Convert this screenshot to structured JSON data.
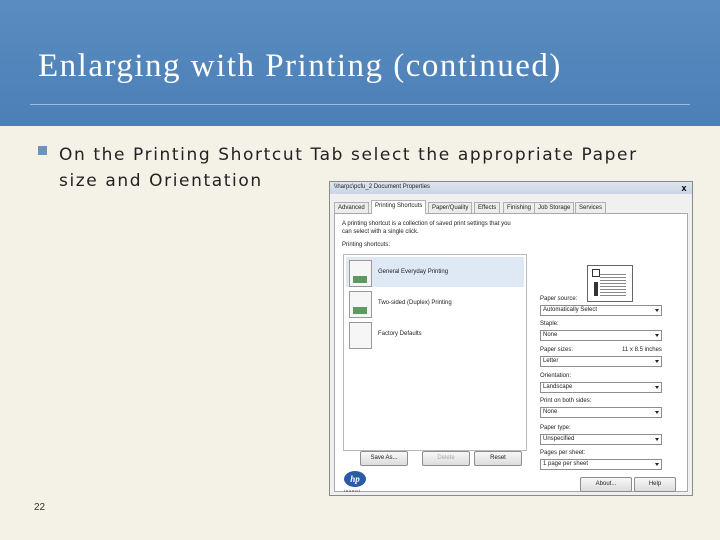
{
  "slide": {
    "title": "Enlarging with Printing (continued)",
    "bullet": "On the Printing Shortcut Tab select the appropriate Paper size and Orientation",
    "slide_number": "22"
  },
  "dialog": {
    "title": "\\\\harpc\\pcfu_2 Document Properties",
    "close_glyph": "x",
    "tabs": [
      {
        "label": "Advanced",
        "active": false
      },
      {
        "label": "Printing Shortcuts",
        "active": true
      },
      {
        "label": "Paper/Quality",
        "active": false
      },
      {
        "label": "Effects",
        "active": false
      },
      {
        "label": "Finishing",
        "active": false
      },
      {
        "label": "Job Storage",
        "active": false
      },
      {
        "label": "Services",
        "active": false
      }
    ],
    "description": "A printing shortcut is a collection of saved print settings that you can select with a single click.",
    "shortcuts_label": "Printing shortcuts:",
    "shortcuts": [
      {
        "label": "General Everyday Printing",
        "selected": true
      },
      {
        "label": "Two-sided (Duplex) Printing",
        "selected": false
      },
      {
        "label": "Factory Defaults",
        "selected": false
      }
    ],
    "buttons": {
      "save_as": "Save As...",
      "delete": "Delete",
      "reset": "Reset",
      "about": "About...",
      "help": "Help"
    },
    "fields": {
      "paper_source": {
        "label": "Paper source:",
        "value": "Automatically Select"
      },
      "staple": {
        "label": "Staple:",
        "value": "None"
      },
      "paper_sizes": {
        "label": "Paper sizes:",
        "extra": "11 x 8.5 inches",
        "value": "Letter"
      },
      "orientation": {
        "label": "Orientation:",
        "value": "Landscape"
      },
      "print_both_sides": {
        "label": "Print on both sides:",
        "value": "None"
      },
      "paper_type": {
        "label": "Paper type:",
        "value": "Unspecified"
      },
      "pages_per_sheet": {
        "label": "Pages per sheet:",
        "value": "1 page per sheet"
      }
    },
    "logo_text": "hp",
    "logo_tagline": "invent"
  },
  "colors": {
    "header": "#4b7fb6",
    "background": "#f4f1e7",
    "selection": "#dfe9f5"
  }
}
